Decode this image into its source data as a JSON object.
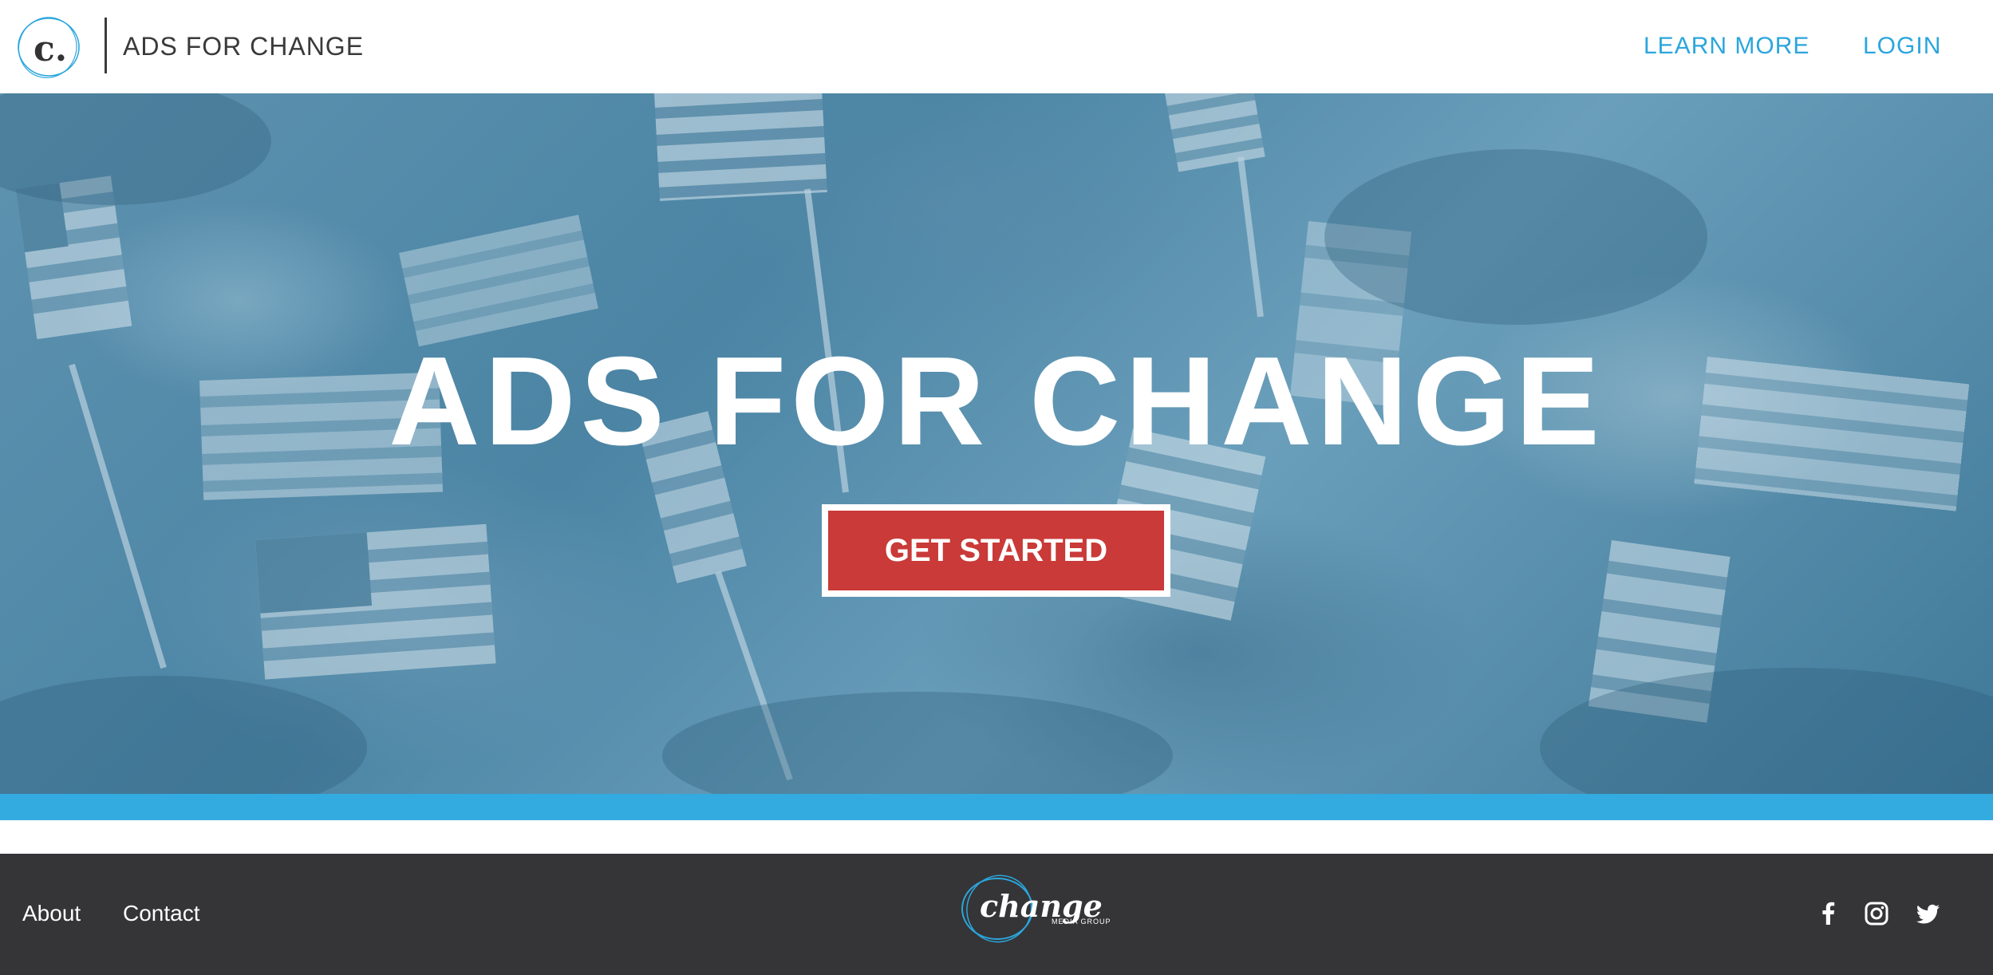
{
  "header": {
    "logo_letter": "c.",
    "brand": "ADS FOR CHANGE",
    "nav": {
      "learn_more": "LEARN MORE",
      "login": "LOGIN"
    }
  },
  "hero": {
    "title": "ADS FOR CHANGE",
    "cta_label": "GET STARTED"
  },
  "footer": {
    "links": {
      "about": "About",
      "contact": "Contact"
    },
    "logo_word": "change",
    "logo_sub": "MEDIA GROUP",
    "social": [
      "facebook-icon",
      "instagram-icon",
      "twitter-icon"
    ]
  },
  "colors": {
    "accent": "#2ba6dc",
    "stripe": "#33aae0",
    "cta": "#c93a38",
    "footer_bg": "#353538"
  }
}
